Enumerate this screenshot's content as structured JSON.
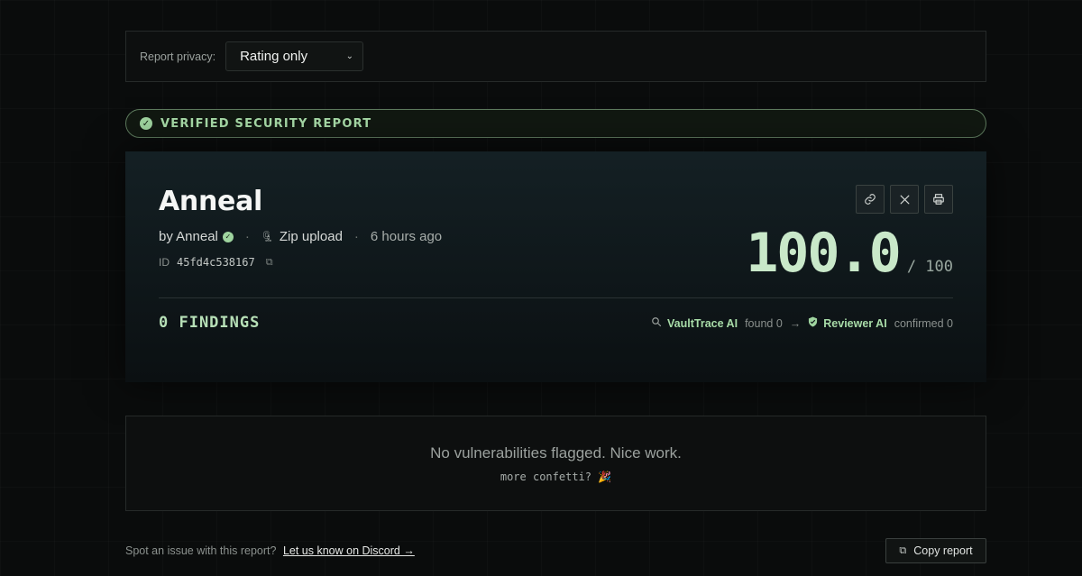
{
  "privacy": {
    "label": "Report privacy:",
    "selected": "Rating only"
  },
  "banner": {
    "text": "VERIFIED SECURITY REPORT"
  },
  "report": {
    "title": "Anneal",
    "author": "by Anneal",
    "source": "Zip upload",
    "time_ago": "6 hours ago",
    "id_label": "ID",
    "id_value": "45fd4c538167",
    "score": "100.0",
    "score_max": "/ 100",
    "findings": "0 FINDINGS",
    "scanner_name": "VaultTrace AI",
    "scanner_status": "found 0",
    "reviewer_name": "Reviewer AI",
    "reviewer_status": "confirmed 0"
  },
  "empty_state": {
    "message": "No vulnerabilities flagged. Nice work.",
    "confetti": "more confetti? 🎉"
  },
  "footer": {
    "text": "Spot an issue with this report?",
    "link": "Let us know on Discord →",
    "copy_button": "Copy report"
  },
  "colors": {
    "accent": "#a8dca8",
    "background": "#0a0c0c"
  }
}
